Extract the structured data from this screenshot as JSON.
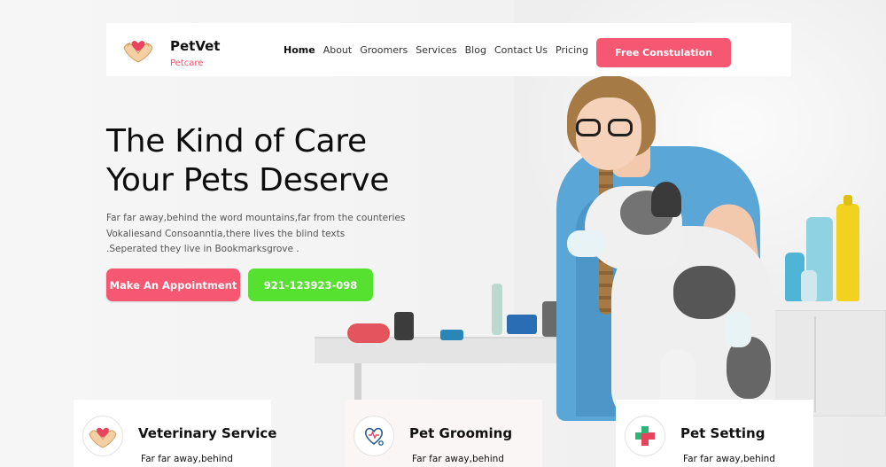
{
  "brand": {
    "name": "PetVet",
    "tagline": "Petcare",
    "accent_color": "#f65771",
    "secondary_color": "#56e02f"
  },
  "nav": {
    "items": [
      {
        "label": "Home",
        "active": true
      },
      {
        "label": "About",
        "active": false
      },
      {
        "label": "Groomers",
        "active": false
      },
      {
        "label": "Services",
        "active": false
      },
      {
        "label": "Blog",
        "active": false
      },
      {
        "label": "Contact Us",
        "active": false
      },
      {
        "label": "Pricing",
        "active": false
      }
    ],
    "cta_label": "Free Constulation"
  },
  "hero": {
    "title_line1": "The Kind of Care",
    "title_line2": "Your Pets Deserve",
    "desc_line1": "Far far away,behind the word mountains,far from the counteries",
    "desc_line2": "Vokaliesand Consoanntia,there lives the blind texts",
    "desc_line3": ".Seperated they live in Bookmarksgrove .",
    "appointment_label": "Make An Appointment",
    "phone_label": "921-123923-098",
    "image_icon": "vet-with-dog-photo"
  },
  "services": [
    {
      "title": "Veterinary Service",
      "text": "Far far away,behind",
      "icon": "heart-hands-icon"
    },
    {
      "title": "Pet Grooming",
      "text": "Far far away,behind",
      "icon": "pet-heart-stethoscope-icon"
    },
    {
      "title": "Pet Setting",
      "text": "Far far away,behind",
      "icon": "medical-cross-icon"
    }
  ]
}
